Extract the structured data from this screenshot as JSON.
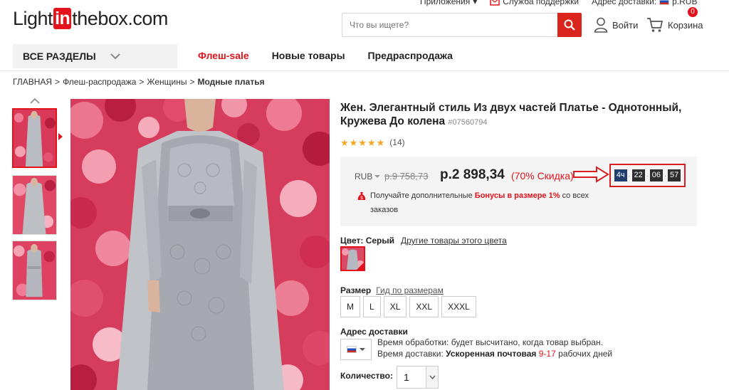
{
  "header": {
    "logo": {
      "light": "Light",
      "in": "in",
      "thebox": "thebox.com"
    },
    "toplinks": {
      "apps": "Приложения",
      "support": "Служба поддержки",
      "ship_to": "Адрес доставки:",
      "currency": "р.RUB"
    },
    "search_placeholder": "Что вы ищете?",
    "login": "Войти",
    "cart": "Корзина",
    "cart_count": "0"
  },
  "nav": {
    "all_sections": "ВСЕ РАЗДЕЛЫ",
    "items": [
      "Флеш-sale",
      "Новые товары",
      "Предраспродажа"
    ]
  },
  "breadcrumb": {
    "items": [
      "ГЛАВНАЯ",
      ">",
      "Флеш-распродажа",
      ">",
      "Женщины",
      ">"
    ],
    "current": "Модные платья"
  },
  "product": {
    "title": "Жен. Элегантный стиль Из двух частей Платье - Однотонный, Кружева До колена",
    "sku": "#07560794",
    "rating_count": "(14)",
    "rating": 5,
    "currency": "RUB",
    "old_price": "р.9 758,73",
    "new_price": "р.2 898,34",
    "discount": "(70% Скидка)",
    "timer": {
      "days": "4ч",
      "hours": "22",
      "minutes": "06",
      "seconds": "57"
    },
    "bonus": {
      "pre": "Получайте дополнительные",
      "highlight": "Бонусы в размере 1%",
      "post": "со всех заказов"
    },
    "color_label": "Цвет: Серый",
    "other_colors": "Другие товары этого цвета",
    "size_label": "Размер",
    "size_guide": "Гид по размерам",
    "sizes": [
      "M",
      "L",
      "XL",
      "XXL",
      "XXXL"
    ],
    "shipping_label": "Адрес доставки",
    "processing": "Время обработки: будет высчитано, когда товар выбран.",
    "delivery": {
      "pre": "Время доставки:",
      "method": "Ускоренная почтовая",
      "days": "9-17",
      "post": "рабочих дней"
    },
    "qty_label": "Количество:",
    "qty": "1"
  },
  "colors": {
    "accent": "#e4131b",
    "price_box": "#f4f4f4",
    "star": "#f5a623"
  }
}
